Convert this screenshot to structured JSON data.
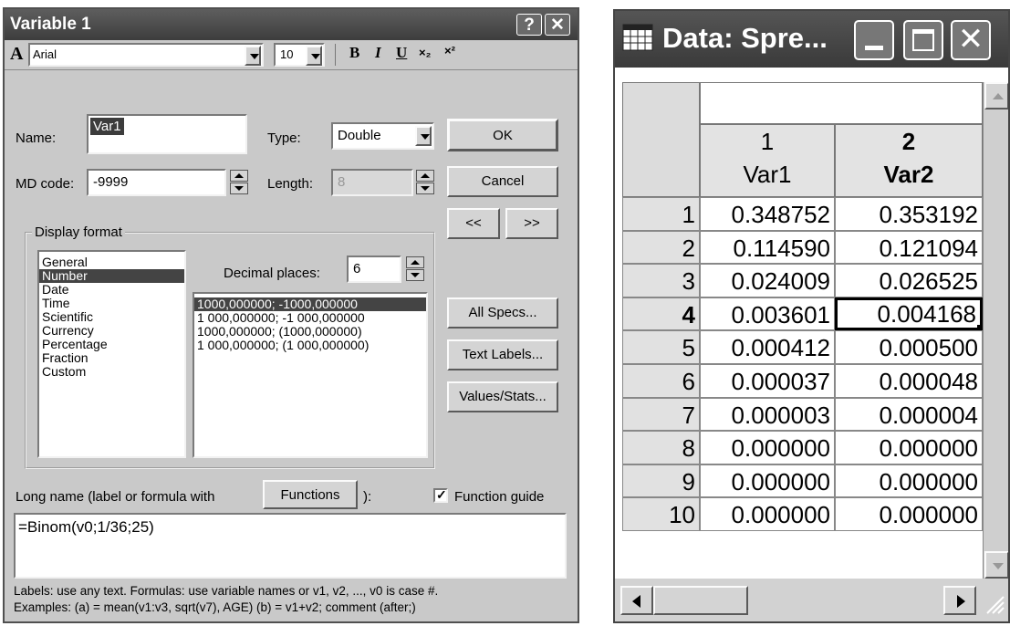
{
  "dialog": {
    "title": "Variable 1",
    "help_label": "?",
    "close_label": "✕",
    "toolbar": {
      "font_icon_label": "A",
      "font_name": "Arial",
      "font_size": "10",
      "bold": "B",
      "italic": "I",
      "underline": "U",
      "subscript": "×₂",
      "superscript": "×²"
    },
    "name_label": "Name:",
    "name_value": "Var1",
    "type_label": "Type:",
    "type_value": "Double",
    "md_code_label": "MD code:",
    "md_code_value": "-9999",
    "length_label": "Length:",
    "length_value": "8",
    "ok_label": "OK",
    "cancel_label": "Cancel",
    "prev_label": "<<",
    "next_label": ">>",
    "display_format": {
      "group_label": "Display format",
      "formats": [
        "General",
        "Number",
        "Date",
        "Time",
        "Scientific",
        "Currency",
        "Percentage",
        "Fraction",
        "Custom"
      ],
      "selected_format": "Number",
      "decimal_label": "Decimal places:",
      "decimal_value": "6",
      "patterns": [
        "1000,000000; -1000,000000",
        "1 000,000000; -1 000,000000",
        "1000,000000; (1000,000000)",
        "1 000,000000; (1 000,000000)"
      ],
      "selected_pattern": "1000,000000; -1000,000000"
    },
    "all_specs_label": "All Specs...",
    "text_labels_label": "Text Labels...",
    "values_stats_label": "Values/Stats...",
    "long_name_prefix": "Long name (label or formula with",
    "functions_label": "Functions",
    "long_name_suffix": "):",
    "function_guide_label": "Function guide",
    "function_guide_checked": true,
    "formula": "=Binom(v0;1/36;25)",
    "help_line1": "Labels: use any text.  Formulas: use variable names or v1, v2, ..., v0 is case #.",
    "help_line2": "Examples:  (a) = mean(v1:v3, sqrt(v7), AGE)  (b) = v1+v2; comment (after;)"
  },
  "spreadsheet": {
    "title": "Data: Spre...",
    "columns": [
      {
        "number": "1",
        "name": "Var1"
      },
      {
        "number": "2",
        "name": "Var2"
      }
    ],
    "rows": [
      {
        "n": "1",
        "v1": "0.348752",
        "v2": "0.353192"
      },
      {
        "n": "2",
        "v1": "0.114590",
        "v2": "0.121094"
      },
      {
        "n": "3",
        "v1": "0.024009",
        "v2": "0.026525"
      },
      {
        "n": "4",
        "v1": "0.003601",
        "v2": "0.004168"
      },
      {
        "n": "5",
        "v1": "0.000412",
        "v2": "0.000500"
      },
      {
        "n": "6",
        "v1": "0.000037",
        "v2": "0.000048"
      },
      {
        "n": "7",
        "v1": "0.000003",
        "v2": "0.000004"
      },
      {
        "n": "8",
        "v1": "0.000000",
        "v2": "0.000000"
      },
      {
        "n": "9",
        "v1": "0.000000",
        "v2": "0.000000"
      },
      {
        "n": "10",
        "v1": "0.000000",
        "v2": "0.000000"
      }
    ],
    "active_row": "4",
    "active_column": "2"
  }
}
